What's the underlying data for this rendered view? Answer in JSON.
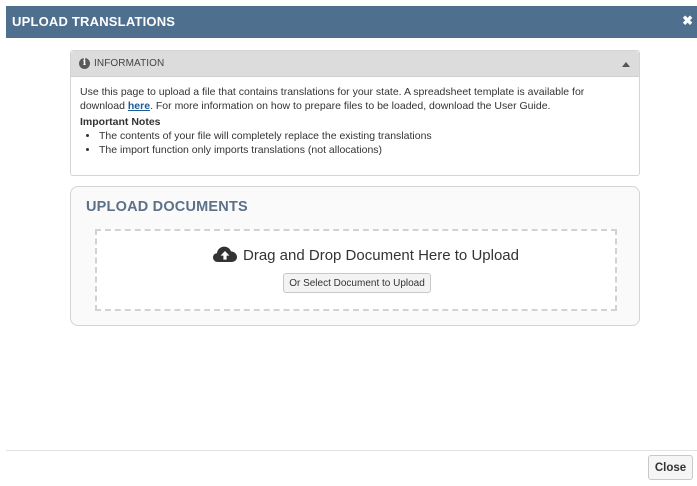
{
  "dialog": {
    "title": "UPLOAD TRANSLATIONS",
    "close_symbol": "✖"
  },
  "info": {
    "title": "INFORMATION",
    "text_before_link": "Use this page to upload a file that contains translations for your state. A spreadsheet template is available for download ",
    "link_text": "here",
    "text_after_link": ". For more information on how to prepare files to be loaded, download the User Guide.",
    "notes_heading": "Important Notes",
    "notes": [
      "The contents of your file will completely replace the existing translations",
      "The import function only imports translations (not allocations)"
    ]
  },
  "upload": {
    "title": "UPLOAD DOCUMENTS",
    "drop_text": "Drag and Drop Document Here to Upload",
    "select_button": "Or Select Document to Upload"
  },
  "footer": {
    "close_label": "Close"
  },
  "colors": {
    "titlebar": "#4f6f8f",
    "link": "#1a5b9a",
    "upload_title": "#5b7089"
  },
  "icons": [
    "info-icon",
    "collapse-up-icon",
    "cloud-upload-icon",
    "close-icon"
  ]
}
